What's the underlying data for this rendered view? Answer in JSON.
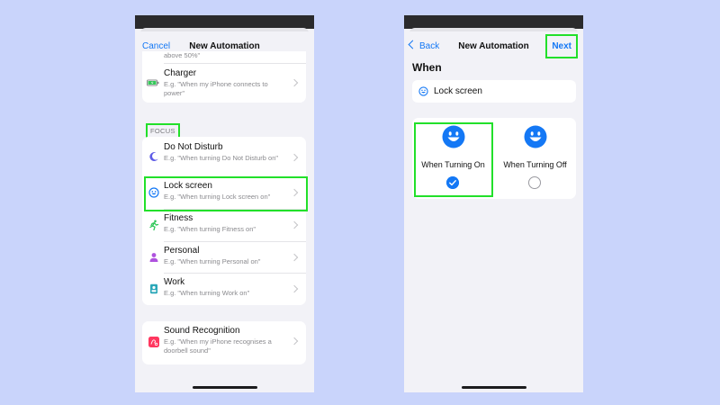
{
  "colors": {
    "background": "#c9d4fb",
    "accent": "#1478f5",
    "highlight": "#22e02a"
  },
  "left_screen": {
    "nav": {
      "cancel_label": "Cancel",
      "title": "New Automation"
    },
    "clipped_subtitle": "above 50%\"",
    "charger": {
      "title": "Charger",
      "subtitle": "E.g. \"When my iPhone connects to power\"",
      "icon": "battery-icon"
    },
    "focus_section_label": "FOCUS",
    "focus_items": [
      {
        "title": "Do Not Disturb",
        "subtitle": "E.g. \"When turning Do Not Disturb on\"",
        "icon": "moon-icon"
      },
      {
        "title": "Lock screen",
        "subtitle": "E.g. \"When turning Lock screen on\"",
        "icon": "smiley-icon",
        "highlighted": true
      },
      {
        "title": "Fitness",
        "subtitle": "E.g. \"When turning Fitness on\"",
        "icon": "running-figure-icon"
      },
      {
        "title": "Personal",
        "subtitle": "E.g. \"When turning Personal on\"",
        "icon": "person-icon"
      },
      {
        "title": "Work",
        "subtitle": "E.g. \"When turning Work on\"",
        "icon": "id-badge-icon"
      }
    ],
    "sound": {
      "title": "Sound Recognition",
      "subtitle": "E.g. \"When my iPhone recognises a doorbell sound\"",
      "icon": "sound-recognition-icon"
    }
  },
  "right_screen": {
    "nav": {
      "back_label": "Back",
      "title": "New Automation",
      "next_label": "Next"
    },
    "when_label": "When",
    "focus_name": "Lock screen",
    "options": [
      {
        "label": "When Turning On",
        "selected": true,
        "icon": "smiley-icon"
      },
      {
        "label": "When Turning Off",
        "selected": false,
        "icon": "smiley-icon"
      }
    ]
  }
}
